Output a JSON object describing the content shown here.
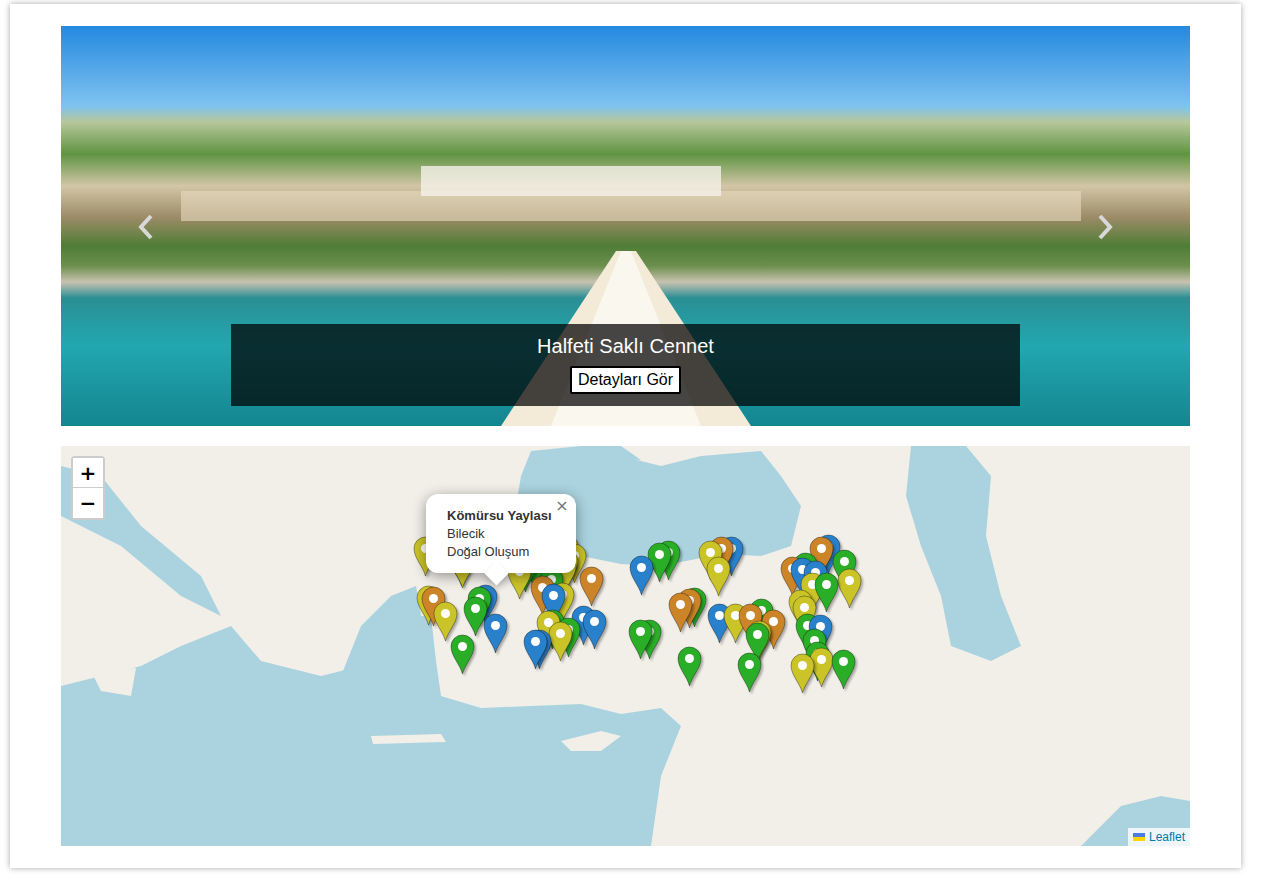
{
  "carousel": {
    "caption": {
      "title": "Halfeti Saklı Cennet",
      "button": "Detayları Gör"
    }
  },
  "map": {
    "zoom": {
      "in": "+",
      "out": "−"
    },
    "popup": {
      "title": "Kömürsu Yaylası",
      "city": "Bilecik",
      "category": "Doğal Oluşum",
      "close": "×"
    },
    "attribution": "Leaflet",
    "markers": [
      {
        "color": "#2aad27"
      },
      {
        "color": "#2a81cb"
      },
      {
        "color": "#cac428"
      },
      {
        "color": "#cb8427"
      },
      {
        "color": "#2aad27"
      },
      {
        "color": "#cac428"
      },
      {
        "color": "#2a81cb"
      },
      {
        "color": "#2aad27"
      },
      {
        "color": "#cac428"
      },
      {
        "color": "#2aad27"
      },
      {
        "color": "#cb8427"
      },
      {
        "color": "#2a81cb"
      },
      {
        "color": "#cac428"
      },
      {
        "color": "#2aad27"
      },
      {
        "color": "#2a81cb"
      },
      {
        "color": "#cac428"
      },
      {
        "color": "#2aad27"
      },
      {
        "color": "#cb8427"
      },
      {
        "color": "#2aad27"
      },
      {
        "color": "#cac428"
      },
      {
        "color": "#2a81cb"
      },
      {
        "color": "#2aad27"
      },
      {
        "color": "#cac428"
      },
      {
        "color": "#2aad27"
      },
      {
        "color": "#cb8427"
      },
      {
        "color": "#2a81cb"
      },
      {
        "color": "#cac428"
      },
      {
        "color": "#2aad27"
      },
      {
        "color": "#cac428"
      },
      {
        "color": "#2a81cb"
      },
      {
        "color": "#2aad27"
      },
      {
        "color": "#cb8427"
      },
      {
        "color": "#cac428"
      },
      {
        "color": "#2aad27"
      },
      {
        "color": "#2a81cb"
      },
      {
        "color": "#cac428"
      },
      {
        "color": "#2aad27"
      },
      {
        "color": "#cac428"
      },
      {
        "color": "#cb8427"
      },
      {
        "color": "#2aad27"
      },
      {
        "color": "#2a81cb"
      },
      {
        "color": "#cac428"
      },
      {
        "color": "#2aad27"
      },
      {
        "color": "#cac428"
      },
      {
        "color": "#2a81cb"
      },
      {
        "color": "#2aad27"
      },
      {
        "color": "#cb8427"
      },
      {
        "color": "#cac428"
      },
      {
        "color": "#2aad27"
      },
      {
        "color": "#2a81cb"
      },
      {
        "color": "#cac428"
      },
      {
        "color": "#2aad27"
      },
      {
        "color": "#cac428"
      },
      {
        "color": "#cb8427"
      },
      {
        "color": "#2aad27"
      },
      {
        "color": "#2a81cb"
      },
      {
        "color": "#cac428"
      },
      {
        "color": "#2aad27"
      },
      {
        "color": "#cac428"
      },
      {
        "color": "#2aad27"
      },
      {
        "color": "#2a81cb"
      },
      {
        "color": "#cb8427"
      },
      {
        "color": "#cac428"
      },
      {
        "color": "#2aad27"
      },
      {
        "color": "#cac428"
      },
      {
        "color": "#2aad27"
      },
      {
        "color": "#2a81cb"
      },
      {
        "color": "#cac428"
      },
      {
        "color": "#2aad27"
      },
      {
        "color": "#cb8427"
      },
      {
        "color": "#cac428"
      },
      {
        "color": "#2aad27"
      }
    ]
  }
}
